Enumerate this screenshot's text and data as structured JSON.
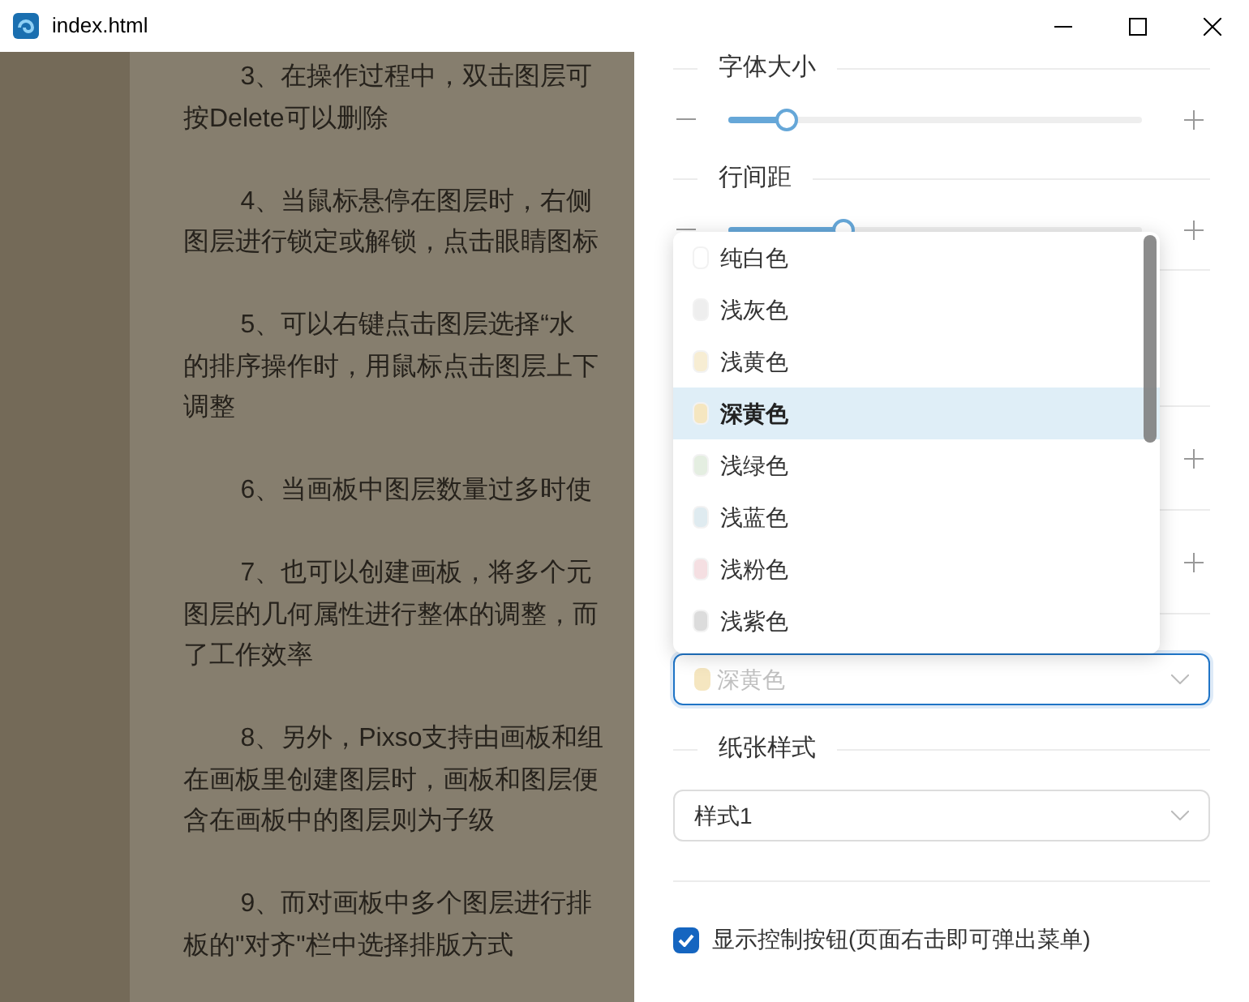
{
  "window": {
    "title": "index.html"
  },
  "document": {
    "paragraphs": [
      {
        "lines": [
          "3、在操作过程中，双击图层可",
          "按Delete可以删除"
        ]
      },
      {
        "lines": [
          "4、当鼠标悬停在图层时，右侧",
          "图层进行锁定或解锁，点击眼睛图标"
        ]
      },
      {
        "lines": [
          "5、可以右键点击图层选择“水",
          "的排序操作时，用鼠标点击图层上下",
          "调整"
        ]
      },
      {
        "lines": [
          "6、当画板中图层数量过多时使"
        ]
      },
      {
        "lines": [
          "7、也可以创建画板，将多个元",
          "图层的几何属性进行整体的调整，而",
          "了工作效率"
        ]
      },
      {
        "lines": [
          "8、另外，Pixso支持由画板和组",
          "在画板里创建图层时，画板和图层便",
          "含在画板中的图层则为子级"
        ]
      },
      {
        "lines": [
          "9、而对画板中多个图层进行排",
          "板的\"对齐\"栏中选择排版方式"
        ]
      }
    ]
  },
  "settings": {
    "sliders": [
      {
        "title": "字体大小",
        "level": 0.14
      },
      {
        "title": "行间距",
        "level": 0.28
      }
    ],
    "background": {
      "value": "深黄色",
      "color": "#f5e6c0",
      "expanded": true,
      "options": [
        {
          "label": "纯白色",
          "color": "#ffffff",
          "selected": false
        },
        {
          "label": "浅灰色",
          "color": "#eeeeee",
          "selected": false
        },
        {
          "label": "浅黄色",
          "color": "#f7edd3",
          "selected": false
        },
        {
          "label": "深黄色",
          "color": "#f5e6c0",
          "selected": true
        },
        {
          "label": "浅绿色",
          "color": "#e4eee1",
          "selected": false
        },
        {
          "label": "浅蓝色",
          "color": "#dfebf0",
          "selected": false
        },
        {
          "label": "浅粉色",
          "color": "#f5dfe2",
          "selected": false
        },
        {
          "label": "浅紫色",
          "color": "#dcdcdc",
          "selected": false
        }
      ]
    },
    "paper_style": {
      "title": "纸张样式",
      "value": "样式1"
    },
    "show_controls": {
      "label": "显示控制按钮(页面右击即可弹出菜单)",
      "checked": true
    }
  }
}
